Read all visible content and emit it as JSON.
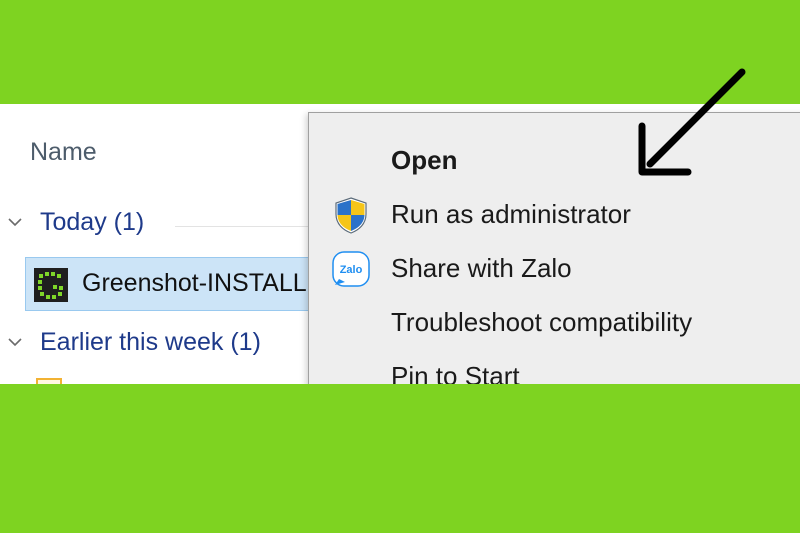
{
  "explorer": {
    "column_header": "Name",
    "groups": [
      {
        "label": "Today (1)"
      },
      {
        "label": "Earlier this week (1)"
      }
    ],
    "files": [
      {
        "name": "Greenshot-INSTALLER",
        "icon": "greenshot-app-icon"
      }
    ]
  },
  "context_menu": {
    "items": [
      {
        "label": "Open",
        "bold": true,
        "icon": ""
      },
      {
        "label": "Run as administrator",
        "icon": "uac-shield-icon"
      },
      {
        "label": "Share with Zalo",
        "icon": "zalo-icon"
      },
      {
        "label": "Troubleshoot compatibility",
        "icon": ""
      },
      {
        "label": "Pin to Start",
        "icon": ""
      }
    ]
  },
  "icons": {
    "zalo_text": "Zalo"
  },
  "colors": {
    "background_green": "#7ed321",
    "selection": "#cce4f7",
    "group_label": "#1e3a8a",
    "menu_bg": "#eeeeee"
  }
}
